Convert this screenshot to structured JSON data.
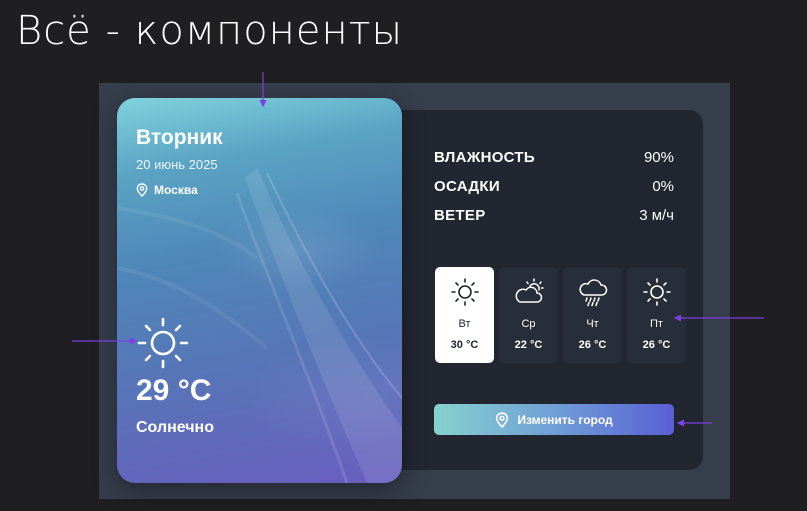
{
  "slide": {
    "title": "Всё - компоненты"
  },
  "card": {
    "day": "Вторник",
    "date": "20 июнь 2025",
    "location": "Москва",
    "icon": "sun-icon",
    "temperature": "29 °C",
    "condition": "Солнечно"
  },
  "stats": [
    {
      "label": "ВЛАЖНОСТЬ",
      "value": "90%"
    },
    {
      "label": "ОСАДКИ",
      "value": "0%"
    },
    {
      "label": "ВЕТЕР",
      "value": "3 м/ч"
    }
  ],
  "forecast": [
    {
      "day": "Вт",
      "temp": "30 °C",
      "icon": "sun-icon",
      "active": true
    },
    {
      "day": "Ср",
      "temp": "22 °C",
      "icon": "partly-cloudy-icon",
      "active": false
    },
    {
      "day": "Чт",
      "temp": "26 °C",
      "icon": "rain-icon",
      "active": false
    },
    {
      "day": "Пт",
      "temp": "26 °C",
      "icon": "sun-icon",
      "active": false
    }
  ],
  "button": {
    "label": "Изменить город",
    "icon": "location-pin-icon"
  },
  "colors": {
    "background": "#1f1f22",
    "stage": "#363d4b",
    "panel": "#212631",
    "tile": "#272d39",
    "annotation_arrow": "#7b3fe4",
    "button_gradient": [
      "#86d2cf",
      "#5a5fd6"
    ]
  }
}
